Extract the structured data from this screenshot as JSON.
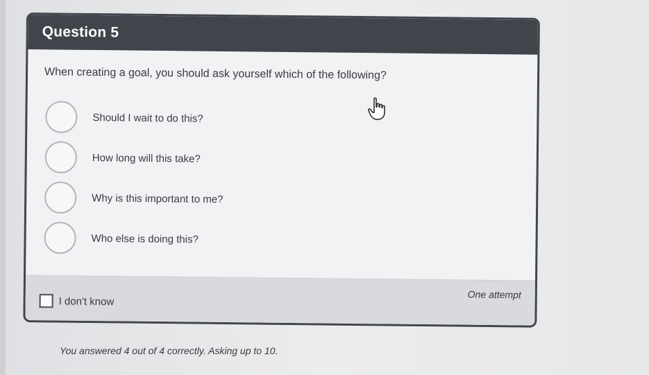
{
  "question": {
    "title": "Question 5",
    "prompt": "When creating a goal, you should ask yourself which of the following?",
    "options": [
      {
        "label": "Should I wait to do this?"
      },
      {
        "label": "How long will this take?"
      },
      {
        "label": "Why is this important to me?"
      },
      {
        "label": "Who else is doing this?"
      }
    ]
  },
  "footer": {
    "idk_label": "I don't know",
    "attempt_label": "One attempt"
  },
  "status": {
    "text": "You answered 4 out of 4 correctly. Asking up to 10."
  },
  "colors": {
    "header": "#42444c",
    "card_background": "#f1f2f4",
    "footer_background": "#d9dadd"
  }
}
